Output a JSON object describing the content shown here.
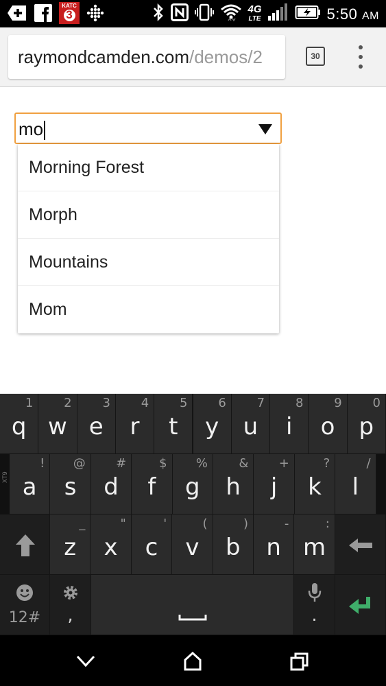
{
  "status_bar": {
    "time": "5:50",
    "ampm": "AM",
    "left_icons": [
      "add-notification-icon",
      "facebook-icon",
      "katc-news-icon",
      "dots-grid-icon"
    ],
    "right_icons": [
      "bluetooth-icon",
      "nfc-icon",
      "vibrate-icon",
      "wifi-icon",
      "4g-lte-icon",
      "signal-icon",
      "battery-charging-icon"
    ],
    "katc_badge": "KATC",
    "katc_number": "3"
  },
  "browser": {
    "url_host": "raymondcamden.com",
    "url_path": "/demos/2",
    "tab_count": "30"
  },
  "combobox": {
    "value": "mo"
  },
  "suggestions": [
    "Morning Forest",
    "Morph",
    "Mountains",
    "Mom"
  ],
  "keyboard": {
    "row1": [
      {
        "main": "q",
        "sub": "1"
      },
      {
        "main": "w",
        "sub": "2"
      },
      {
        "main": "e",
        "sub": "3"
      },
      {
        "main": "r",
        "sub": "4"
      },
      {
        "main": "t",
        "sub": "5"
      },
      {
        "main": "y",
        "sub": "6"
      },
      {
        "main": "u",
        "sub": "7"
      },
      {
        "main": "i",
        "sub": "8"
      },
      {
        "main": "o",
        "sub": "9"
      },
      {
        "main": "p",
        "sub": "0"
      }
    ],
    "row2": [
      {
        "main": "a",
        "sub": "!"
      },
      {
        "main": "s",
        "sub": "@"
      },
      {
        "main": "d",
        "sub": "#"
      },
      {
        "main": "f",
        "sub": "$"
      },
      {
        "main": "g",
        "sub": "%"
      },
      {
        "main": "h",
        "sub": "&"
      },
      {
        "main": "j",
        "sub": "+"
      },
      {
        "main": "k",
        "sub": "?"
      },
      {
        "main": "l",
        "sub": "/"
      }
    ],
    "row3": [
      {
        "main": "z",
        "sub": "_"
      },
      {
        "main": "x",
        "sub": "\""
      },
      {
        "main": "c",
        "sub": "'"
      },
      {
        "main": "v",
        "sub": "("
      },
      {
        "main": "b",
        "sub": ")"
      },
      {
        "main": "n",
        "sub": "-"
      },
      {
        "main": "m",
        "sub": ":"
      }
    ],
    "xt9_label": "XT9",
    "symbols_label": "12#",
    "comma": ",",
    "period": "."
  },
  "colors": {
    "combo_border": "#f0a040",
    "enter_key": "#3fae6a"
  }
}
